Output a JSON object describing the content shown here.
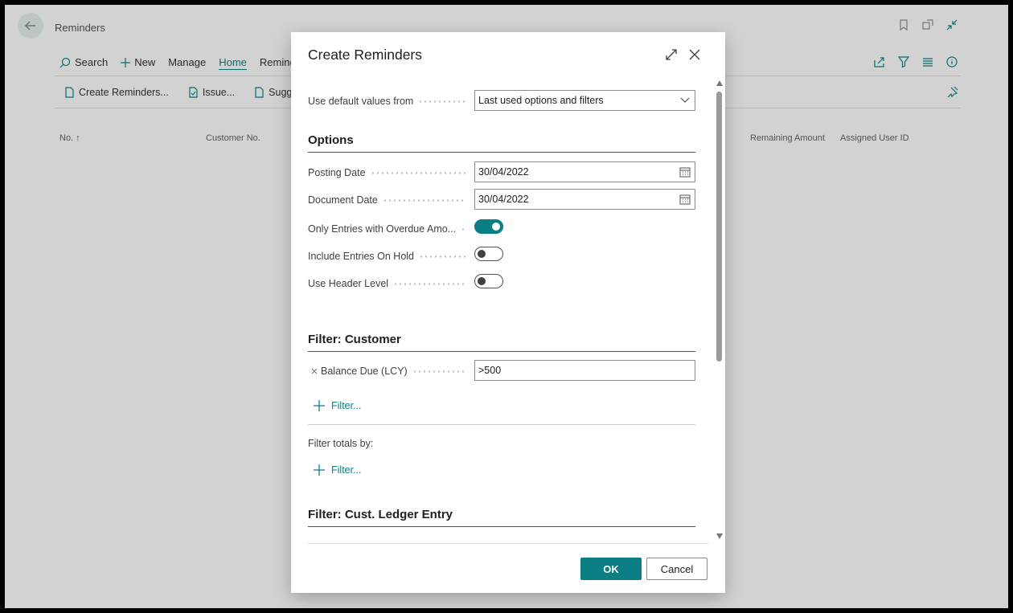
{
  "page": {
    "title": "Reminders",
    "commands": [
      "Search",
      "New",
      "Manage",
      "Home",
      "Remind"
    ],
    "active_command": "Home",
    "actions": [
      "Create Reminders...",
      "Issue...",
      "Sugge"
    ],
    "columns": [
      "No. ↑",
      "Customer No.",
      "Remaining Amount",
      "Assigned User ID"
    ]
  },
  "dialog": {
    "title": "Create Reminders",
    "default_values": {
      "label": "Use default values from",
      "value": "Last used options and filters"
    },
    "options_section": "Options",
    "posting_date": {
      "label": "Posting Date",
      "value": "30/04/2022"
    },
    "document_date": {
      "label": "Document Date",
      "value": "30/04/2022"
    },
    "toggles": [
      {
        "label": "Only Entries with Overdue Amo...",
        "on": true
      },
      {
        "label": "Include Entries On Hold",
        "on": false
      },
      {
        "label": "Use Header Level",
        "on": false
      }
    ],
    "customer_section": "Filter: Customer",
    "balance_filter": {
      "label": "Balance Due (LCY)",
      "value": ">500"
    },
    "add_filter_label": "Filter...",
    "filter_totals_label": "Filter totals by:",
    "add_totals_filter_label": "Filter...",
    "ledger_section": "Filter: Cust. Ledger Entry",
    "ok_label": "OK",
    "cancel_label": "Cancel"
  },
  "colors": {
    "accent": "#0a7e83"
  }
}
